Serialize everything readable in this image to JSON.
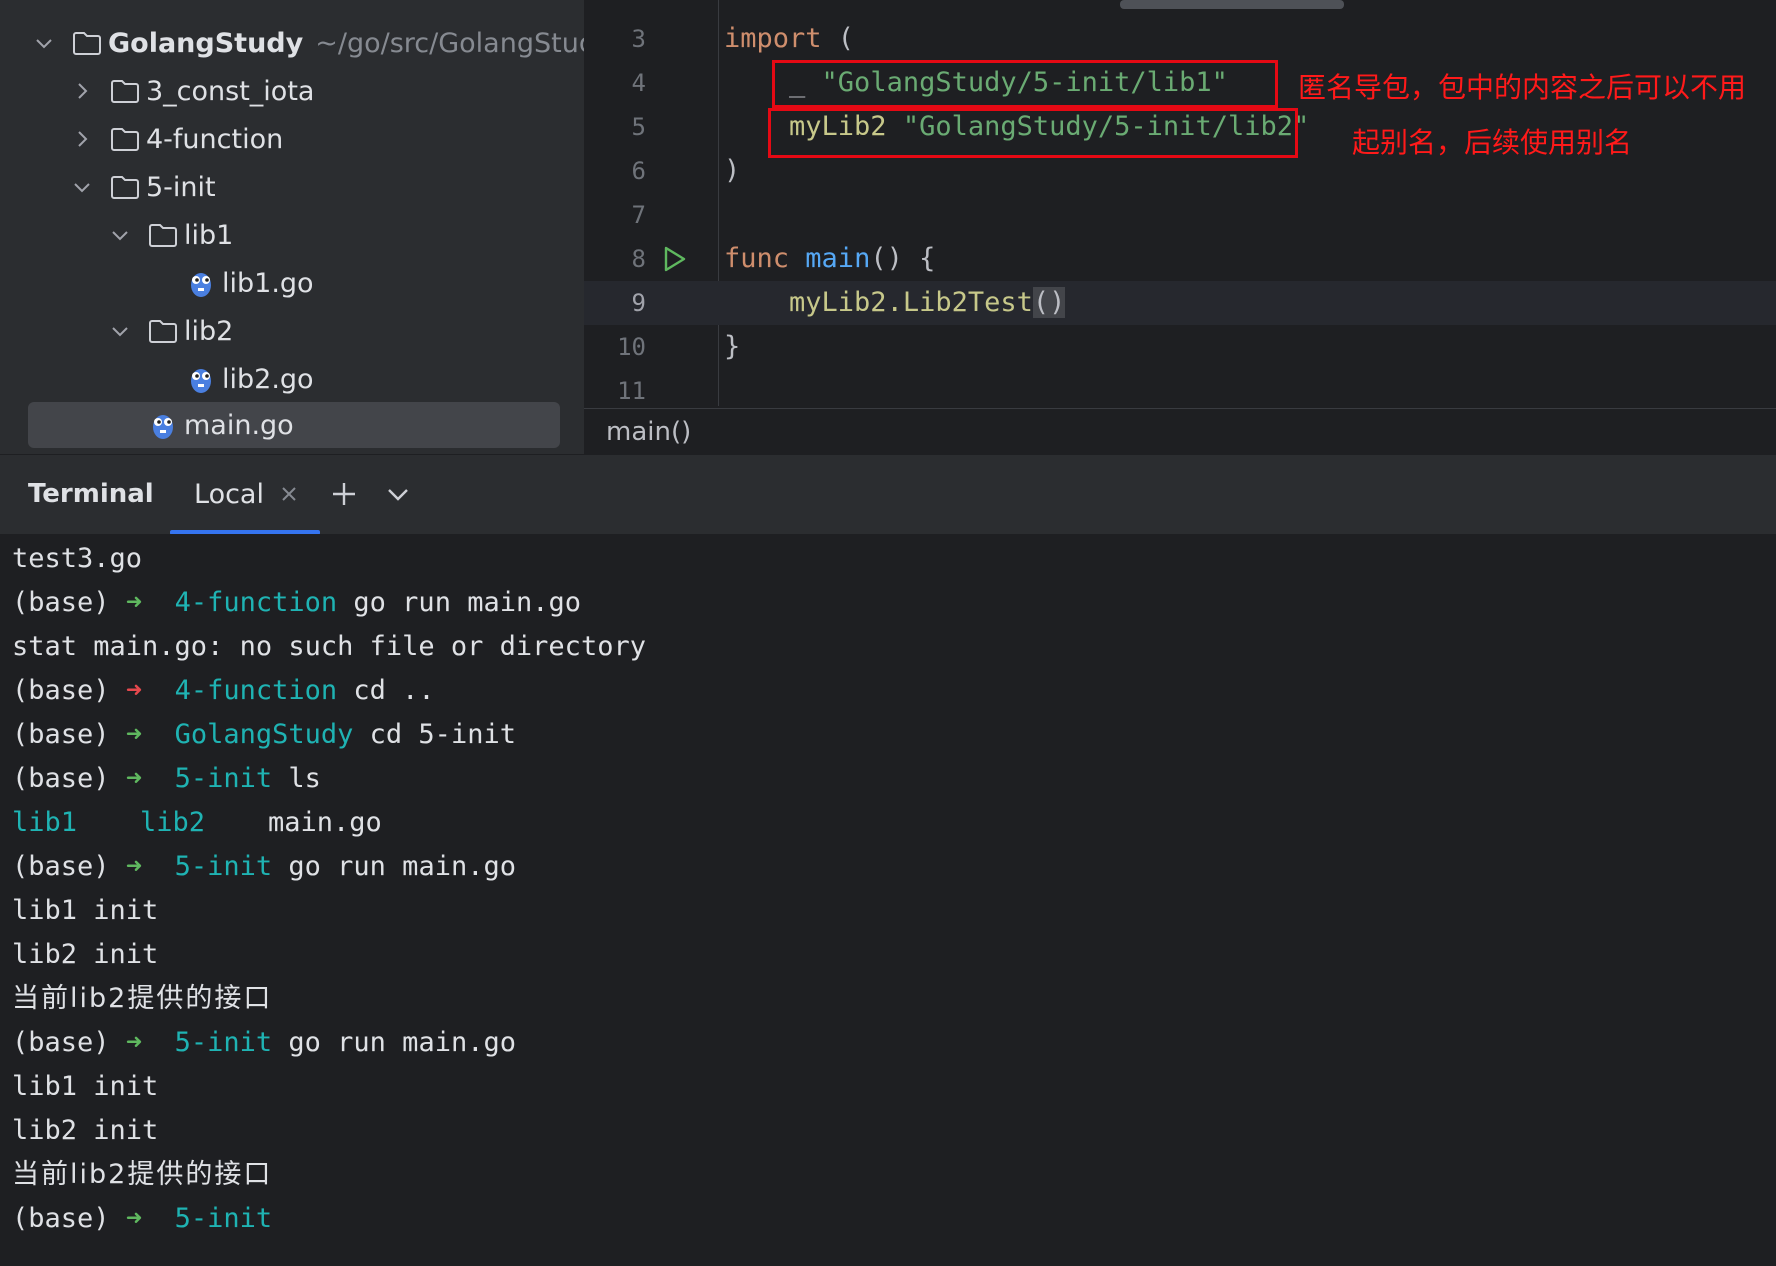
{
  "colors": {
    "accent": "#3574f0",
    "annotation": "#ff1a1a",
    "prompt_ok": "#5fb85f",
    "prompt_err": "#e5484d",
    "dir": "#1fb3b3"
  },
  "project": {
    "root_name": "GolangStudy",
    "root_path": "~/go/src/GolangStudy",
    "items": [
      {
        "label": "3_const_iota",
        "type": "folder",
        "state": "collapsed"
      },
      {
        "label": "4-function",
        "type": "folder",
        "state": "collapsed"
      },
      {
        "label": "5-init",
        "type": "folder",
        "state": "expanded"
      },
      {
        "label": "lib1",
        "type": "folder",
        "state": "expanded"
      },
      {
        "label": "lib1.go",
        "type": "go-file"
      },
      {
        "label": "lib2",
        "type": "folder",
        "state": "expanded"
      },
      {
        "label": "lib2.go",
        "type": "go-file"
      },
      {
        "label": "main.go",
        "type": "go-file",
        "selected": true
      }
    ]
  },
  "editor": {
    "lines": [
      {
        "n": "3",
        "kw": "import",
        "rest": " ("
      },
      {
        "n": "4",
        "pre": "    _ ",
        "str": "\"GolangStudy/5-init/lib1\""
      },
      {
        "n": "5",
        "pre": "    ",
        "alias": "myLib2",
        "str": "\"GolangStudy/5-init/lib2\""
      },
      {
        "n": "6",
        "text": ")"
      },
      {
        "n": "7",
        "text": ""
      },
      {
        "n": "8",
        "kw": "func",
        "fn": "main",
        "rest": "() {"
      },
      {
        "n": "9",
        "pre": "    ",
        "pkg": "myLib2",
        "call": ".Lib2Test",
        "paren": "()"
      },
      {
        "n": "10",
        "text": "}"
      },
      {
        "n": "11",
        "text": ""
      }
    ],
    "annotation_1": "匿名导包，包中的内容之后可以不用",
    "annotation_2": "起别名，后续使用别名",
    "breadcrumb": "main()"
  },
  "terminal": {
    "title": "Terminal",
    "tab_label": "Local",
    "lines": [
      {
        "kind": "out",
        "text": "test3.go"
      },
      {
        "kind": "prompt",
        "env": "(base)",
        "arrow": "➜",
        "status": "ok",
        "dir": "4-function",
        "cmd": " go run main.go"
      },
      {
        "kind": "out",
        "text": "stat main.go: no such file or directory"
      },
      {
        "kind": "prompt",
        "env": "(base)",
        "arrow": "➜",
        "status": "err",
        "dir": "4-function",
        "cmd": " cd .."
      },
      {
        "kind": "prompt",
        "env": "(base)",
        "arrow": "➜",
        "status": "ok",
        "dir": "GolangStudy",
        "cmd": " cd 5-init"
      },
      {
        "kind": "prompt",
        "env": "(base)",
        "arrow": "➜",
        "status": "ok",
        "dir": "5-init",
        "cmd": " ls"
      },
      {
        "kind": "ls",
        "items": [
          "lib1",
          "lib2",
          "main.go"
        ]
      },
      {
        "kind": "prompt",
        "env": "(base)",
        "arrow": "➜",
        "status": "ok",
        "dir": "5-init",
        "cmd": " go run main.go"
      },
      {
        "kind": "out",
        "text": "lib1 init"
      },
      {
        "kind": "out",
        "text": "lib2 init"
      },
      {
        "kind": "cjk",
        "text": "当前lib2提供的接口"
      },
      {
        "kind": "prompt",
        "env": "(base)",
        "arrow": "➜",
        "status": "ok",
        "dir": "5-init",
        "cmd": " go run main.go"
      },
      {
        "kind": "out",
        "text": "lib1 init"
      },
      {
        "kind": "out",
        "text": "lib2 init"
      },
      {
        "kind": "cjk",
        "text": "当前lib2提供的接口"
      },
      {
        "kind": "prompt",
        "env": "(base)",
        "arrow": "➜",
        "status": "ok",
        "dir": "5-init",
        "cmd": ""
      }
    ]
  }
}
